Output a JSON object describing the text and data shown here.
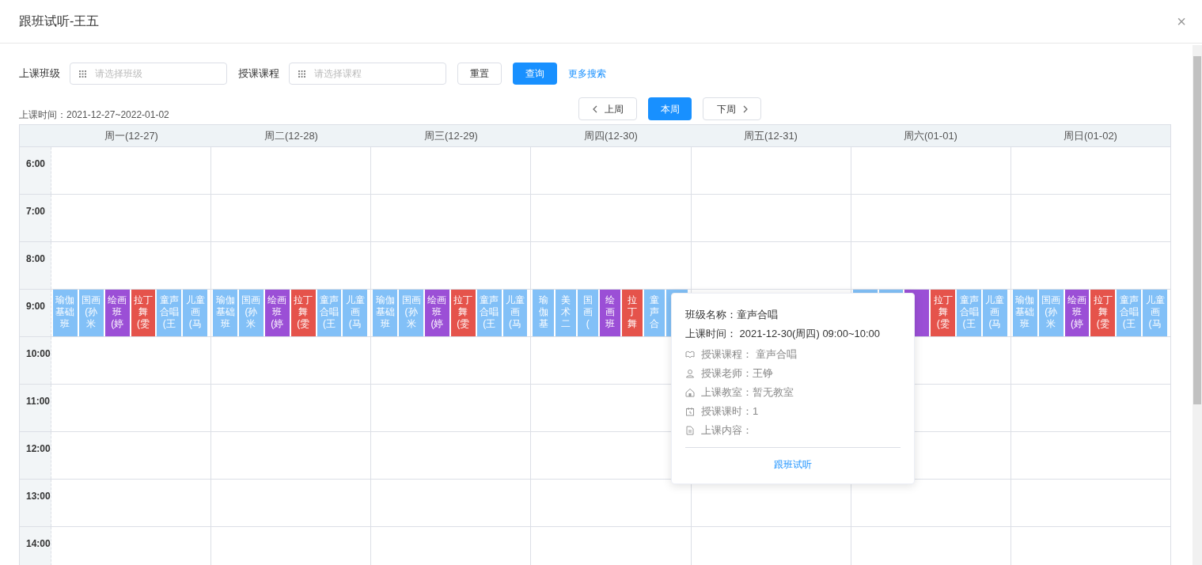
{
  "dialog": {
    "title": "跟班试听-王五",
    "close": "×"
  },
  "filters": [
    {
      "label": "上课班级",
      "placeholder": "请选择班级"
    },
    {
      "label": "授课课程",
      "placeholder": "请选择课程"
    }
  ],
  "buttons": {
    "reset": "重置",
    "query": "查询",
    "more": "更多搜索"
  },
  "range_label": "上课时间：2021-12-27~2022-01-02",
  "week_nav": [
    {
      "label": "上周",
      "kind": "prev",
      "selected": false
    },
    {
      "label": "本周",
      "kind": "current",
      "selected": true
    },
    {
      "label": "下周",
      "kind": "next",
      "selected": false
    }
  ],
  "days": [
    {
      "label": "周一(12-27)",
      "events": [
        {
          "label": "瑜伽基础班",
          "color": "#82c0f7"
        },
        {
          "label": "国画(孙米",
          "color": "#82c0f7"
        },
        {
          "label": "绘画班(婷",
          "color": "#9b4fd6"
        },
        {
          "label": "拉丁舞(雯",
          "color": "#e5534b"
        },
        {
          "label": "童声合唱(王",
          "color": "#82c0f7"
        },
        {
          "label": "儿童画(马",
          "color": "#82c0f7"
        }
      ]
    },
    {
      "label": "周二(12-28)",
      "events": [
        {
          "label": "瑜伽基础班",
          "color": "#82c0f7"
        },
        {
          "label": "国画(孙米",
          "color": "#82c0f7"
        },
        {
          "label": "绘画班(婷",
          "color": "#9b4fd6"
        },
        {
          "label": "拉丁舞(雯",
          "color": "#e5534b"
        },
        {
          "label": "童声合唱(王",
          "color": "#82c0f7"
        },
        {
          "label": "儿童画(马",
          "color": "#82c0f7"
        }
      ]
    },
    {
      "label": "周三(12-29)",
      "events": [
        {
          "label": "瑜伽基础班",
          "color": "#82c0f7"
        },
        {
          "label": "国画(孙米",
          "color": "#82c0f7"
        },
        {
          "label": "绘画班(婷",
          "color": "#9b4fd6"
        },
        {
          "label": "拉丁舞(雯",
          "color": "#e5534b"
        },
        {
          "label": "童声合唱(王",
          "color": "#82c0f7"
        },
        {
          "label": "儿童画(马",
          "color": "#82c0f7"
        }
      ]
    },
    {
      "label": "周四(12-30)",
      "events": [
        {
          "label": "瑜伽基",
          "color": "#82c0f7"
        },
        {
          "label": "美术二",
          "color": "#82c0f7"
        },
        {
          "label": "国画(",
          "color": "#82c0f7"
        },
        {
          "label": "绘画班",
          "color": "#9b4fd6"
        },
        {
          "label": "拉丁舞",
          "color": "#e5534b"
        },
        {
          "label": "童声合",
          "color": "#82c0f7"
        },
        {
          "color": "#82c0f7"
        }
      ]
    },
    {
      "label": "周五(12-31)"
    },
    {
      "label": "周六(01-01)",
      "events": [
        {
          "color": "#82c0f7"
        },
        {
          "color": "#82c0f7"
        },
        {
          "color": "#9b4fd6"
        },
        {
          "label": "拉丁舞(雯",
          "color": "#e5534b"
        },
        {
          "label": "童声合唱(王",
          "color": "#82c0f7"
        },
        {
          "label": "儿童画(马",
          "color": "#82c0f7"
        }
      ]
    },
    {
      "label": "周日(01-02)",
      "events": [
        {
          "label": "瑜伽基础班",
          "color": "#82c0f7"
        },
        {
          "label": "国画(孙米",
          "color": "#82c0f7"
        },
        {
          "label": "绘画班(婷",
          "color": "#9b4fd6"
        },
        {
          "label": "拉丁舞(雯",
          "color": "#e5534b"
        },
        {
          "label": "童声合唱(王",
          "color": "#82c0f7"
        },
        {
          "label": "儿童画(马",
          "color": "#82c0f7"
        }
      ]
    }
  ],
  "times": [
    "6:00",
    "7:00",
    "8:00",
    "9:00",
    "10:00",
    "11:00",
    "12:00",
    "13:00",
    "14:00"
  ],
  "popover": {
    "class_name": "班级名称：童声合唱",
    "time": "上课时间： 2021-12-30(周四) 09:00~10:00",
    "details": [
      {
        "kind": "course",
        "text": "授课课程： 童声合唱"
      },
      {
        "kind": "teacher",
        "text": "授课老师：王铮"
      },
      {
        "kind": "room",
        "text": "上课教室：暂无教室"
      },
      {
        "kind": "hours",
        "text": "授课课时：1"
      },
      {
        "kind": "content",
        "text": "上课内容："
      }
    ],
    "action": "跟班试听"
  }
}
